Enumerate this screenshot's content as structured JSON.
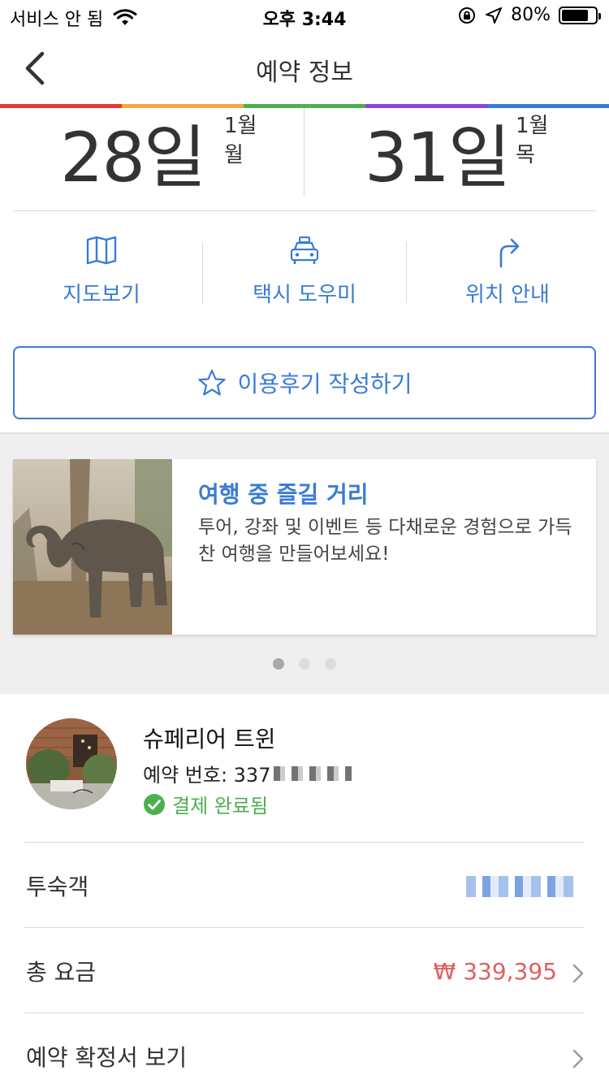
{
  "status_bar": {
    "carrier": "서비스 안 됨",
    "time": "오후 3:44",
    "battery": "80%",
    "battery_level": 0.8
  },
  "header": {
    "title": "예약 정보"
  },
  "rainbow_colors": [
    "#e53935",
    "#f2a83b",
    "#4caf50",
    "#8e44d8",
    "#3a7bd5"
  ],
  "dates": {
    "checkin": {
      "day": "28일",
      "month": "1월",
      "weekday": "월"
    },
    "checkout": {
      "day": "31일",
      "month": "1월",
      "weekday": "목"
    }
  },
  "actions": [
    {
      "label": "지도보기",
      "icon": "map-icon"
    },
    {
      "label": "택시 도우미",
      "icon": "taxi-icon"
    },
    {
      "label": "위치 안내",
      "icon": "directions-arrow-icon"
    }
  ],
  "review_button": {
    "label": "이용후기 작성하기",
    "icon": "star-outline-icon"
  },
  "promo": {
    "title": "여행 중 즐길 거리",
    "text": "투어, 강좌 및 이벤트 등 다채로운 경험으로 가득찬 여행을 만들어보세요!",
    "image": "elephant-photo",
    "page_count": 3,
    "active_page": 1
  },
  "hotel": {
    "name": "슈페리어 트윈",
    "booking_label": "예약 번호: 337",
    "status": "결제 완료됨",
    "status_icon": "check-circle-icon",
    "photo": "hotel-courtyard-photo"
  },
  "rows": {
    "guests": {
      "label": "투숙객"
    },
    "total": {
      "label": "총 요금",
      "value": "₩ 339,395"
    },
    "confirmation": {
      "label": "예약 확정서 보기"
    }
  },
  "colors": {
    "accent": "#3a7bd5",
    "success": "#4caf50",
    "price": "#e06060"
  }
}
